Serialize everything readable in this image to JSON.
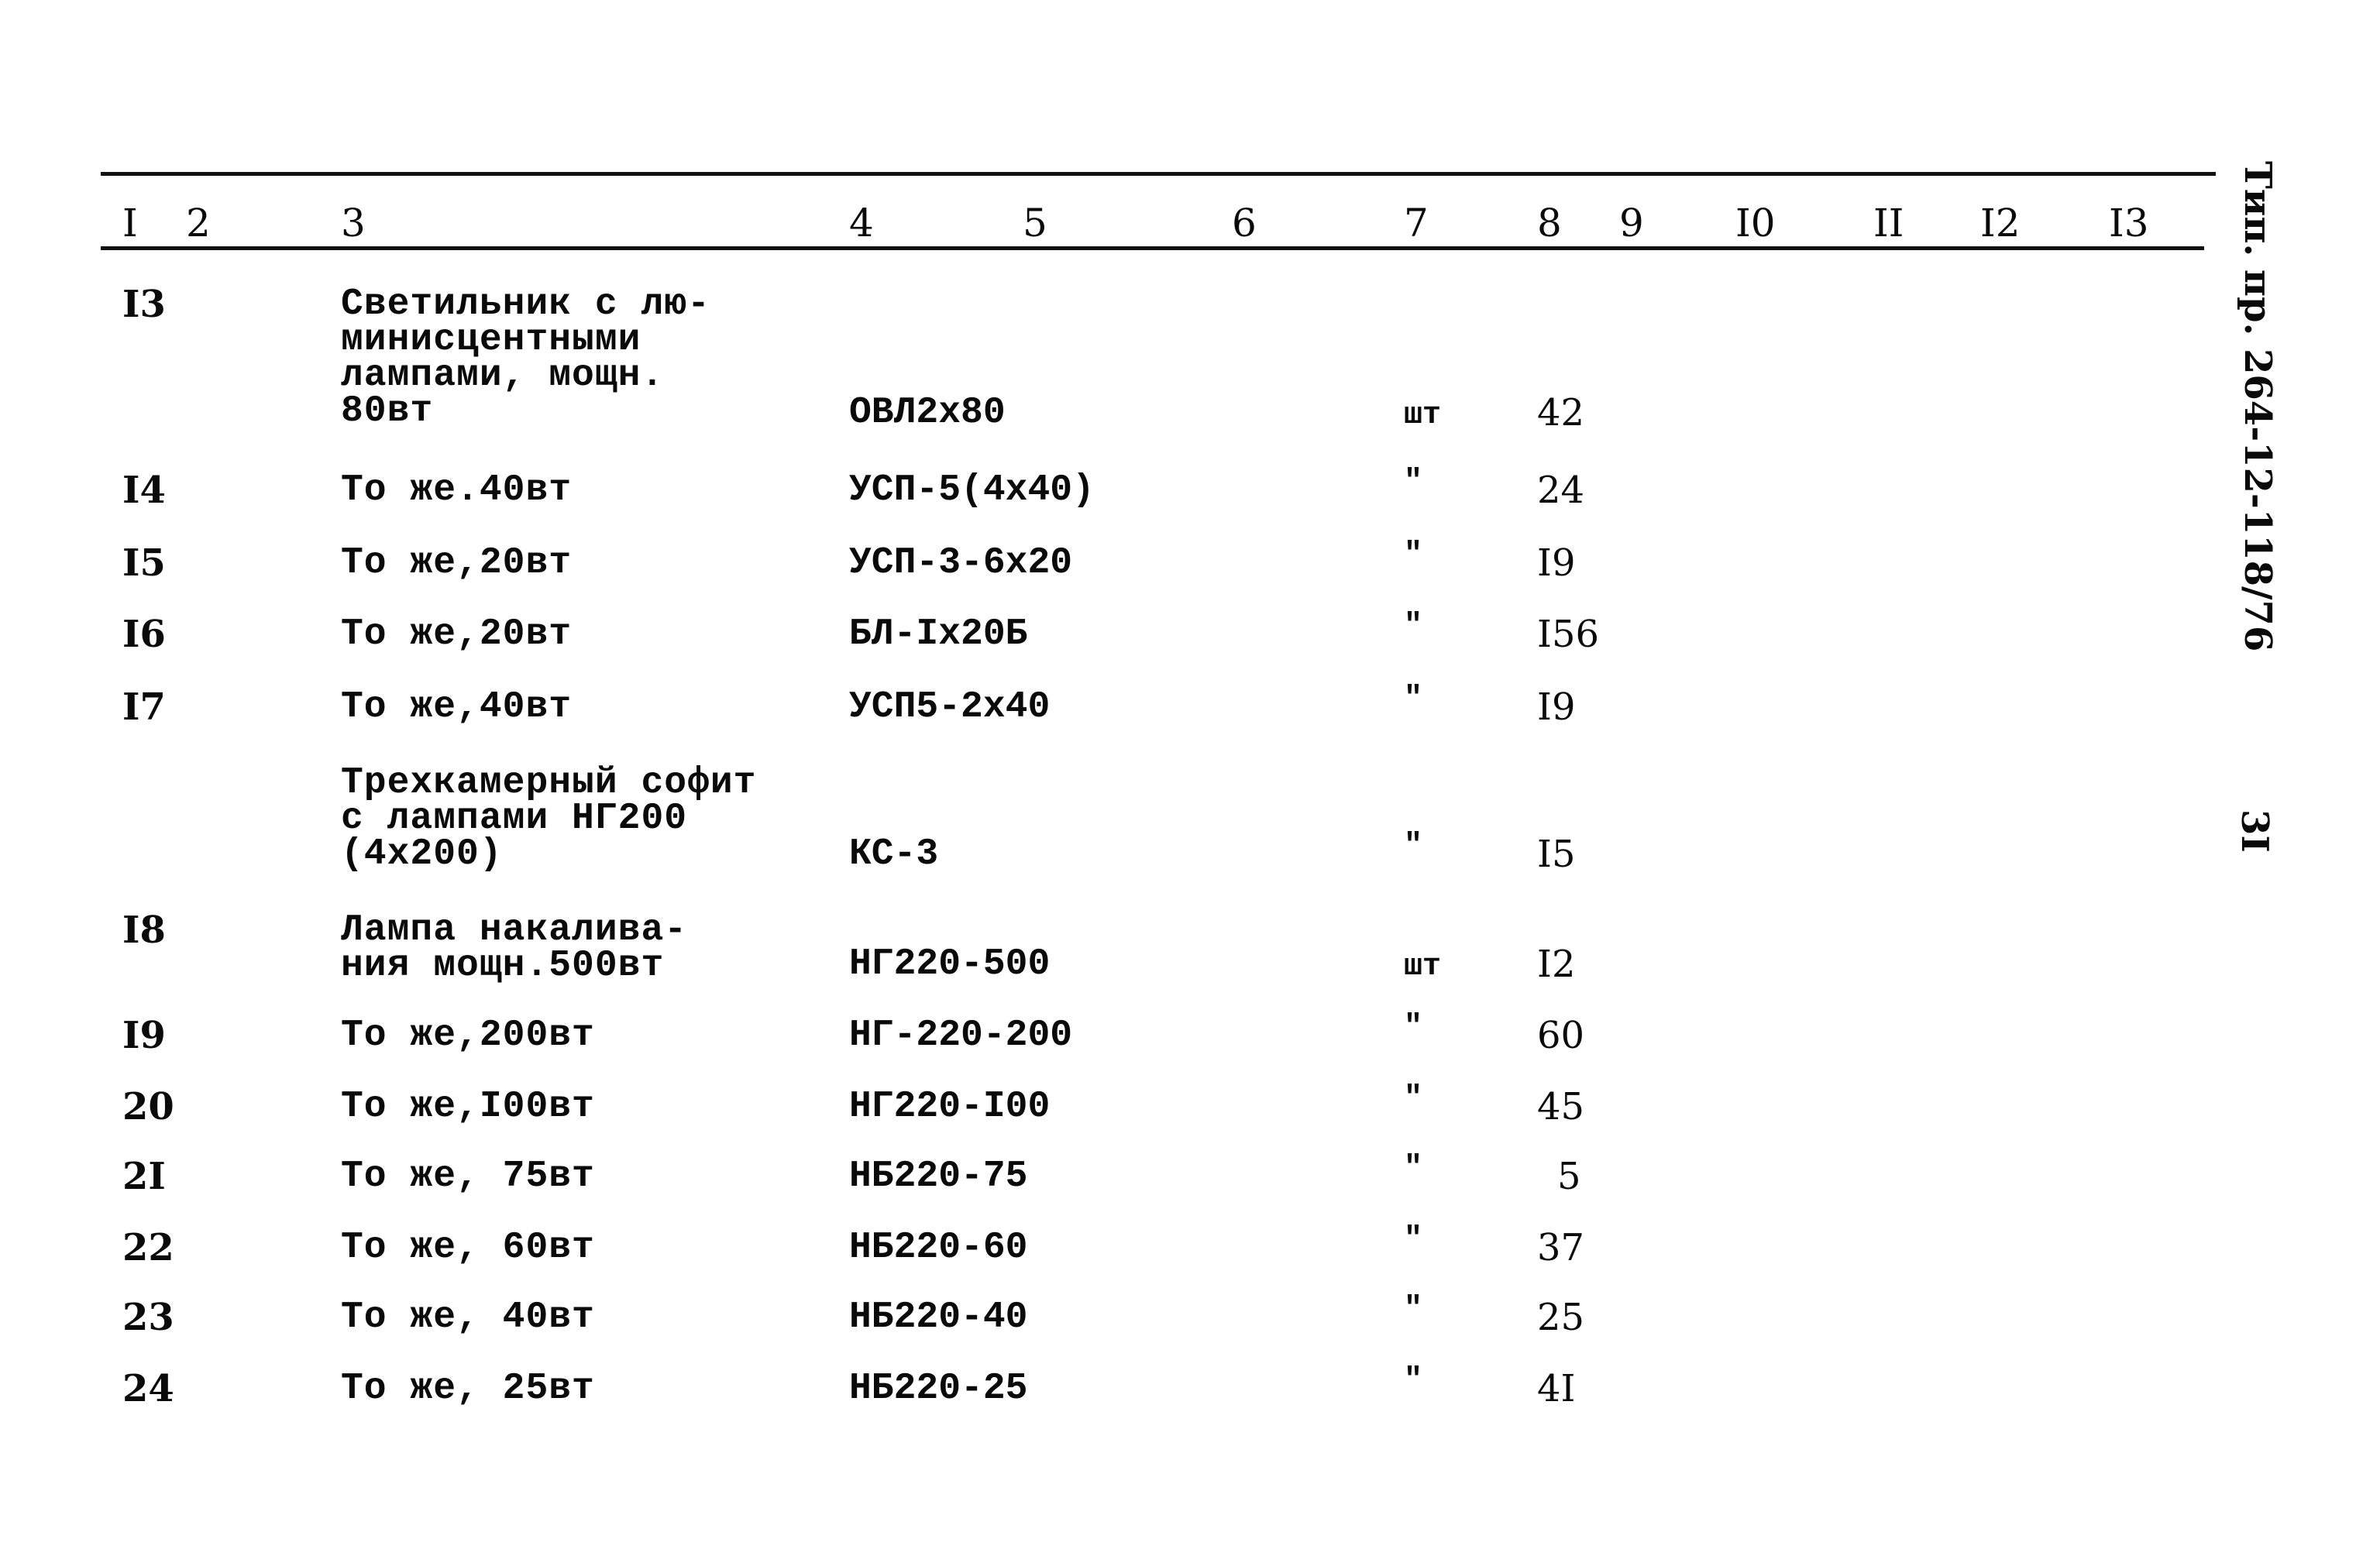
{
  "document": {
    "side_code": "Тип. пр. 264-12-118/76",
    "page_number": "3I"
  },
  "table": {
    "column_headers": [
      "I",
      "2",
      "3",
      "4",
      "5",
      "6",
      "7",
      "8",
      "9",
      "I0",
      "II",
      "I2",
      "I3"
    ],
    "rows": [
      {
        "no": "I3",
        "name": "Светильник с лю-\nминисцентными\nлампами, мощн.\n80вт",
        "mark": "ОВЛ2х80",
        "unit": "шт",
        "qty": "42"
      },
      {
        "no": "I4",
        "name": "То же.40вт",
        "mark": "УСП-5(4х40)",
        "unit": "\"",
        "qty": "24"
      },
      {
        "no": "I5",
        "name": "То же,20вт",
        "mark": "УСП-3-6х20",
        "unit": "\"",
        "qty": "I9"
      },
      {
        "no": "I6",
        "name": "То же,20вт",
        "mark": "БЛ-Iх20Б",
        "unit": "\"",
        "qty": "I56"
      },
      {
        "no": "I7",
        "name": "То же,40вт",
        "mark": "УСП5-2х40",
        "unit": "\"",
        "qty": "I9"
      },
      {
        "no": "",
        "name": "Трехкамерный софит\nс лампами НГ200\n(4х200)",
        "mark": "КС-3",
        "unit": "\"",
        "qty": "I5"
      },
      {
        "no": "I8",
        "name": "Лампа накалива-\nния мощн.500вт",
        "mark": "НГ220-500",
        "unit": "шт",
        "qty": "I2"
      },
      {
        "no": "I9",
        "name": "То же,200вт",
        "mark": "НГ-220-200",
        "unit": "\"",
        "qty": "60"
      },
      {
        "no": "20",
        "name": "То же,I00вт",
        "mark": "НГ220-I00",
        "unit": "\"",
        "qty": "45"
      },
      {
        "no": "2I",
        "name": "То же, 75вт",
        "mark": "НБ220-75",
        "unit": "\"",
        "qty": "5"
      },
      {
        "no": "22",
        "name": "То же, 60вт",
        "mark": "НБ220-60",
        "unit": "\"",
        "qty": "37"
      },
      {
        "no": "23",
        "name": "То же, 40вт",
        "mark": "НБ220-40",
        "unit": "\"",
        "qty": "25"
      },
      {
        "no": "24",
        "name": "То же, 25вт",
        "mark": "НБ220-25",
        "unit": "\"",
        "qty": "4I"
      }
    ]
  }
}
